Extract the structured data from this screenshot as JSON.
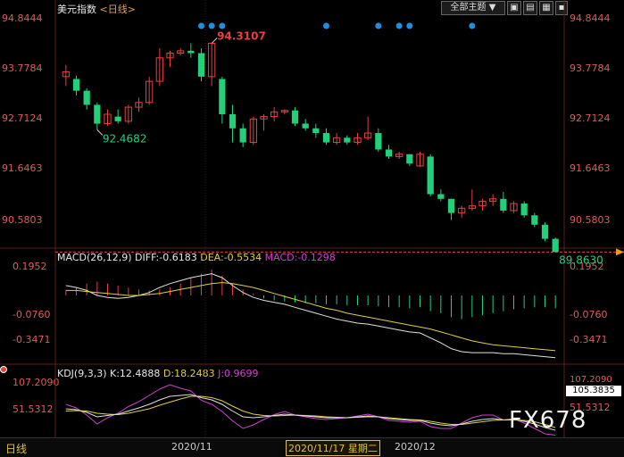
{
  "header": {
    "title": "美元指数",
    "period": "<日线>",
    "dropdown_label": "全部主题",
    "dropdown_arrow": "▼"
  },
  "toolbar": {
    "btn1": "▣",
    "btn2": "▤",
    "btn3": "▦"
  },
  "price_axis": {
    "ticks": [
      "94.8444",
      "93.7784",
      "92.7124",
      "91.6463",
      "90.5803"
    ]
  },
  "annotations": {
    "high_label": "94.3107",
    "low_label": "92.4682",
    "last_label": "89.8630"
  },
  "macd": {
    "title": "MACD(26,12,9)",
    "diff_label": "DIFF:-0.6183",
    "dea_label": "DEA:-0.5534",
    "macd_label": "MACD:-0.1298",
    "ticks": [
      "0.1952",
      "-0.0760",
      "-0.3471"
    ]
  },
  "kdj": {
    "title": "KDJ(9,3,3)",
    "k_label": "K:12.4888",
    "d_label": "D:18.2483",
    "j_label": "J:0.9699",
    "ticks_left": [
      "107.2090",
      "51.5312"
    ],
    "ticks_right": [
      "107.2090",
      "105.3835",
      "51.5312"
    ]
  },
  "bottom": {
    "period_label": "日线",
    "date_1": "2020/11",
    "date_cursor": "2020/11/17 星期二",
    "date_2": "2020/12"
  },
  "watermark": "FX678",
  "colors": {
    "up": "#e84040",
    "down": "#22d07a",
    "diff": "#e0e0e0",
    "dea": "#e0d040",
    "j": "#d040d0",
    "dot": "#1e8ee0"
  },
  "chart_data": {
    "type": "candlestick",
    "ylim": [
      89.8,
      94.85
    ],
    "candles": [
      {
        "o": 93.6,
        "h": 93.85,
        "l": 93.4,
        "c": 93.7
      },
      {
        "o": 93.55,
        "h": 93.62,
        "l": 93.2,
        "c": 93.3
      },
      {
        "o": 93.3,
        "h": 93.35,
        "l": 92.9,
        "c": 93.0
      },
      {
        "o": 93.0,
        "h": 93.05,
        "l": 92.47,
        "c": 92.6
      },
      {
        "o": 92.6,
        "h": 92.9,
        "l": 92.55,
        "c": 92.8
      },
      {
        "o": 92.75,
        "h": 92.9,
        "l": 92.6,
        "c": 92.65
      },
      {
        "o": 92.65,
        "h": 93.0,
        "l": 92.6,
        "c": 92.95
      },
      {
        "o": 92.95,
        "h": 93.15,
        "l": 92.85,
        "c": 93.05
      },
      {
        "o": 93.05,
        "h": 93.6,
        "l": 93.0,
        "c": 93.5
      },
      {
        "o": 93.5,
        "h": 94.2,
        "l": 93.4,
        "c": 94.0
      },
      {
        "o": 94.0,
        "h": 94.15,
        "l": 93.8,
        "c": 94.1
      },
      {
        "o": 94.1,
        "h": 94.2,
        "l": 94.05,
        "c": 94.15
      },
      {
        "o": 94.15,
        "h": 94.31,
        "l": 94.0,
        "c": 94.1
      },
      {
        "o": 94.1,
        "h": 94.2,
        "l": 93.5,
        "c": 93.6
      },
      {
        "o": 93.6,
        "h": 94.31,
        "l": 93.4,
        "c": 94.31
      },
      {
        "o": 93.55,
        "h": 93.6,
        "l": 92.6,
        "c": 92.8
      },
      {
        "o": 92.8,
        "h": 93.0,
        "l": 92.2,
        "c": 92.5
      },
      {
        "o": 92.5,
        "h": 92.6,
        "l": 92.1,
        "c": 92.2
      },
      {
        "o": 92.2,
        "h": 92.75,
        "l": 92.15,
        "c": 92.7
      },
      {
        "o": 92.7,
        "h": 92.8,
        "l": 92.45,
        "c": 92.75
      },
      {
        "o": 92.75,
        "h": 92.95,
        "l": 92.65,
        "c": 92.85
      },
      {
        "o": 92.85,
        "h": 92.9,
        "l": 92.8,
        "c": 92.88
      },
      {
        "o": 92.88,
        "h": 92.95,
        "l": 92.55,
        "c": 92.6
      },
      {
        "o": 92.6,
        "h": 92.7,
        "l": 92.45,
        "c": 92.5
      },
      {
        "o": 92.5,
        "h": 92.6,
        "l": 92.3,
        "c": 92.4
      },
      {
        "o": 92.4,
        "h": 92.5,
        "l": 92.15,
        "c": 92.2
      },
      {
        "o": 92.2,
        "h": 92.4,
        "l": 92.15,
        "c": 92.3
      },
      {
        "o": 92.3,
        "h": 92.35,
        "l": 92.15,
        "c": 92.2
      },
      {
        "o": 92.2,
        "h": 92.4,
        "l": 92.15,
        "c": 92.3
      },
      {
        "o": 92.3,
        "h": 92.75,
        "l": 92.25,
        "c": 92.4
      },
      {
        "o": 92.4,
        "h": 92.5,
        "l": 92.0,
        "c": 92.05
      },
      {
        "o": 92.05,
        "h": 92.15,
        "l": 91.85,
        "c": 91.9
      },
      {
        "o": 91.9,
        "h": 92.0,
        "l": 91.85,
        "c": 91.95
      },
      {
        "o": 91.95,
        "h": 91.95,
        "l": 91.7,
        "c": 91.75
      },
      {
        "o": 91.7,
        "h": 92.0,
        "l": 91.68,
        "c": 91.95
      },
      {
        "o": 91.9,
        "h": 91.95,
        "l": 91.05,
        "c": 91.1
      },
      {
        "o": 91.1,
        "h": 91.2,
        "l": 90.95,
        "c": 91.0
      },
      {
        "o": 91.0,
        "h": 91.0,
        "l": 90.55,
        "c": 90.7
      },
      {
        "o": 90.7,
        "h": 90.85,
        "l": 90.6,
        "c": 90.8
      },
      {
        "o": 90.8,
        "h": 91.2,
        "l": 90.75,
        "c": 90.85
      },
      {
        "o": 90.85,
        "h": 91.0,
        "l": 90.75,
        "c": 90.95
      },
      {
        "o": 90.95,
        "h": 91.1,
        "l": 90.85,
        "c": 91.0
      },
      {
        "o": 91.0,
        "h": 91.15,
        "l": 90.7,
        "c": 90.75
      },
      {
        "o": 90.75,
        "h": 90.95,
        "l": 90.7,
        "c": 90.9
      },
      {
        "o": 90.9,
        "h": 90.95,
        "l": 90.6,
        "c": 90.65
      },
      {
        "o": 90.65,
        "h": 90.7,
        "l": 90.4,
        "c": 90.45
      },
      {
        "o": 90.45,
        "h": 90.5,
        "l": 90.1,
        "c": 90.15
      },
      {
        "o": 90.15,
        "h": 90.18,
        "l": 89.86,
        "c": 89.87
      }
    ],
    "macd_hist": [
      0.05,
      0.08,
      0.12,
      0.14,
      0.12,
      0.1,
      0.08,
      0.06,
      0.05,
      0.06,
      0.08,
      0.12,
      0.18,
      0.22,
      0.26,
      0.2,
      0.12,
      0.06,
      0.02,
      -0.03,
      -0.05,
      -0.06,
      -0.07,
      -0.08,
      -0.08,
      -0.09,
      -0.09,
      -0.1,
      -0.1,
      -0.1,
      -0.11,
      -0.12,
      -0.12,
      -0.13,
      -0.12,
      -0.16,
      -0.18,
      -0.22,
      -0.24,
      -0.22,
      -0.2,
      -0.18,
      -0.16,
      -0.14,
      -0.13,
      -0.12,
      -0.12,
      -0.13
    ],
    "diff": [
      0.1,
      0.08,
      0.05,
      0.0,
      -0.02,
      -0.03,
      -0.02,
      0.0,
      0.03,
      0.08,
      0.12,
      0.15,
      0.18,
      0.2,
      0.22,
      0.18,
      0.1,
      0.03,
      -0.02,
      -0.05,
      -0.07,
      -0.09,
      -0.12,
      -0.15,
      -0.18,
      -0.21,
      -0.24,
      -0.26,
      -0.28,
      -0.29,
      -0.31,
      -0.33,
      -0.35,
      -0.37,
      -0.38,
      -0.43,
      -0.48,
      -0.54,
      -0.57,
      -0.58,
      -0.58,
      -0.58,
      -0.59,
      -0.59,
      -0.6,
      -0.61,
      -0.62,
      -0.63
    ],
    "dea": [
      0.05,
      0.05,
      0.04,
      0.03,
      0.02,
      0.01,
      0.0,
      0.0,
      0.01,
      0.02,
      0.04,
      0.06,
      0.08,
      0.1,
      0.12,
      0.13,
      0.12,
      0.1,
      0.08,
      0.05,
      0.02,
      -0.01,
      -0.04,
      -0.07,
      -0.1,
      -0.13,
      -0.15,
      -0.18,
      -0.2,
      -0.22,
      -0.24,
      -0.26,
      -0.28,
      -0.3,
      -0.32,
      -0.34,
      -0.37,
      -0.4,
      -0.43,
      -0.46,
      -0.48,
      -0.5,
      -0.51,
      -0.52,
      -0.53,
      -0.54,
      -0.55,
      -0.56
    ],
    "k": [
      60,
      58,
      52,
      42,
      45,
      48,
      55,
      62,
      70,
      80,
      88,
      90,
      92,
      85,
      80,
      70,
      55,
      42,
      40,
      42,
      45,
      48,
      46,
      44,
      42,
      40,
      40,
      40,
      42,
      44,
      42,
      38,
      36,
      34,
      34,
      28,
      24,
      22,
      26,
      32,
      36,
      38,
      35,
      36,
      32,
      26,
      18,
      12
    ],
    "d": [
      55,
      56,
      55,
      50,
      48,
      47,
      50,
      55,
      60,
      68,
      75,
      82,
      88,
      88,
      85,
      78,
      66,
      55,
      48,
      45,
      44,
      45,
      46,
      45,
      44,
      42,
      41,
      40,
      41,
      42,
      42,
      40,
      38,
      36,
      35,
      32,
      28,
      25,
      25,
      28,
      31,
      34,
      35,
      35,
      34,
      31,
      25,
      18
    ],
    "j": [
      70,
      62,
      46,
      26,
      40,
      50,
      65,
      76,
      90,
      104,
      114,
      106,
      100,
      79,
      70,
      54,
      33,
      16,
      24,
      36,
      47,
      54,
      46,
      42,
      38,
      36,
      38,
      40,
      44,
      48,
      42,
      34,
      32,
      30,
      32,
      20,
      16,
      16,
      28,
      40,
      46,
      46,
      35,
      38,
      28,
      16,
      4,
      1
    ]
  }
}
